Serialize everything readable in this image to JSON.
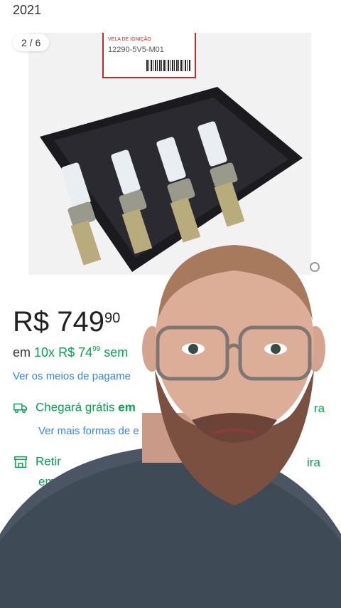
{
  "header": {
    "year_text": "2021"
  },
  "gallery": {
    "counter": "2 / 6",
    "box_small_text": "VELA DE IGNIÇÃO",
    "box_code": "12290-5V5-M01"
  },
  "price": {
    "main": "R$ 749",
    "cents": "90"
  },
  "installments": {
    "prefix": "em",
    "count": "10x",
    "amount": "R$ 74",
    "amount_cents": "99",
    "suffix": "sem"
  },
  "payment_link": "Ver os meios de pagame",
  "shipping": {
    "label": "Chegará grátis",
    "label_bold": "em",
    "trailing": "ra",
    "more_link": "Ver mais formas de e"
  },
  "pickup": {
    "label": "Retir",
    "trailing": "ira",
    "second_line": "em"
  },
  "colors": {
    "green": "#00a650",
    "link_blue": "#3483fa"
  },
  "icons": {
    "shipping": "truck-icon",
    "pickup": "store-icon"
  }
}
